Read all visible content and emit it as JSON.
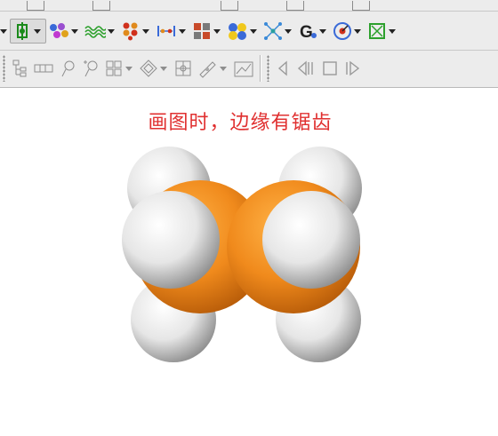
{
  "caption": "画图时，边缘有锯齿",
  "colors": {
    "carbon": "#f08a1c",
    "hydrogen": "#f4f4f4",
    "caption": "#e03030",
    "toolbar_bg": "#ececec"
  },
  "toolbar_row1": {
    "icons": [
      "grid-icon",
      "sort-icon",
      "cursor-icon",
      "rotate-icon",
      "window-icon"
    ]
  },
  "toolbar_row2": {
    "tools": [
      {
        "name": "chirality-icon",
        "has_dropdown": true
      },
      {
        "name": "molecule-color-icon",
        "has_dropdown": true
      },
      {
        "name": "wave-icon",
        "has_dropdown": true
      },
      {
        "name": "cluster-icon",
        "has_dropdown": true
      },
      {
        "name": "measure-distance-icon",
        "has_dropdown": true
      },
      {
        "name": "lattice-icon",
        "has_dropdown": true
      },
      {
        "name": "spheres-icon",
        "has_dropdown": true
      },
      {
        "name": "scatter-icon",
        "has_dropdown": true
      },
      {
        "name": "g-icon",
        "has_dropdown": true
      },
      {
        "name": "target-icon",
        "has_dropdown": true
      },
      {
        "name": "box-icon",
        "has_dropdown": true
      }
    ]
  },
  "toolbar_row3": {
    "tools": [
      {
        "name": "tree-icon",
        "has_dropdown": false
      },
      {
        "name": "ribbon-icon",
        "has_dropdown": false
      },
      {
        "name": "ring-icon",
        "has_dropdown": false
      },
      {
        "name": "ring-star-icon",
        "has_dropdown": false
      },
      {
        "name": "lattice-build-icon",
        "has_dropdown": true
      },
      {
        "name": "diamond-icon",
        "has_dropdown": true
      },
      {
        "name": "grid-box-icon",
        "has_dropdown": false
      },
      {
        "name": "pencil-icon",
        "has_dropdown": true
      },
      {
        "name": "graph-icon",
        "has_dropdown": false
      }
    ],
    "media": [
      "prev-icon",
      "step-back-icon",
      "stop-icon",
      "play-icon"
    ]
  }
}
